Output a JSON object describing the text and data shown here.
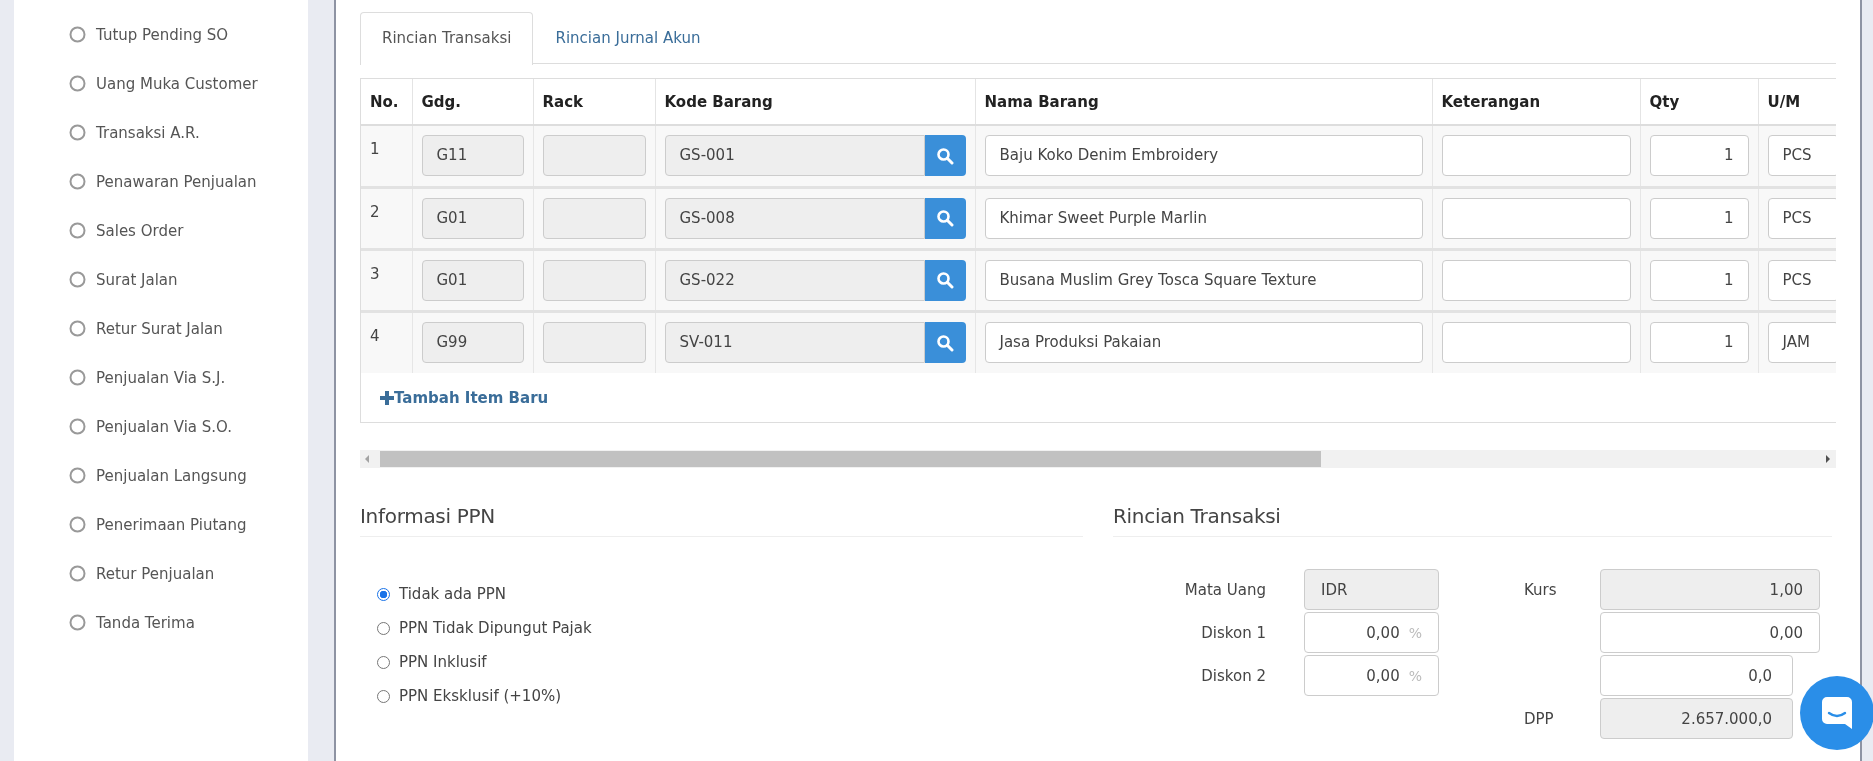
{
  "sidebar": {
    "items": [
      {
        "label": "Tutup Pending SO"
      },
      {
        "label": "Uang Muka Customer"
      },
      {
        "label": "Transaksi A.R."
      },
      {
        "label": "Penawaran Penjualan"
      },
      {
        "label": "Sales Order"
      },
      {
        "label": "Surat Jalan"
      },
      {
        "label": "Retur Surat Jalan"
      },
      {
        "label": "Penjualan Via S.J."
      },
      {
        "label": "Penjualan Via S.O."
      },
      {
        "label": "Penjualan Langsung"
      },
      {
        "label": "Penerimaan Piutang"
      },
      {
        "label": "Retur Penjualan"
      },
      {
        "label": "Tanda Terima"
      }
    ]
  },
  "tabs": [
    {
      "label": "Rincian Transaksi",
      "selected": true
    },
    {
      "label": "Rincian Jurnal Akun",
      "selected": false
    }
  ],
  "table": {
    "columns": [
      "No.",
      "Gdg.",
      "Rack",
      "Kode Barang",
      "Nama Barang",
      "Keterangan",
      "Qty",
      "U/M"
    ],
    "rows": [
      {
        "no": "1",
        "warehouse": "G11",
        "item_code": "GS-001",
        "item_name": "Baju Koko Denim Embroidery",
        "qty": "1",
        "unit": "PCS"
      },
      {
        "no": "2",
        "warehouse": "G01",
        "item_code": "GS-008",
        "item_name": "Khimar Sweet Purple Marlin",
        "qty": "1",
        "unit": "PCS"
      },
      {
        "no": "3",
        "warehouse": "G01",
        "item_code": "GS-022",
        "item_name": "Busana Muslim Grey Tosca Square Texture",
        "qty": "1",
        "unit": "PCS"
      },
      {
        "no": "4",
        "warehouse": "G99",
        "item_code": "SV-011",
        "item_name": "Jasa Produksi Pakaian",
        "qty": "1",
        "unit": "JAM"
      }
    ],
    "add_item_link": "Tambah Item Baru"
  },
  "ppn": {
    "title": "Informasi PPN",
    "options": [
      {
        "label": "Tidak ada PPN",
        "selected": true
      },
      {
        "label": "PPN Tidak Dipungut Pajak",
        "selected": false
      },
      {
        "label": "PPN Inklusif",
        "selected": false
      },
      {
        "label": "PPN Eksklusif (+10%)",
        "selected": false
      }
    ]
  },
  "summary": {
    "title": "Rincian Transaksi",
    "left_fields": [
      {
        "label": "Mata Uang",
        "value": "IDR",
        "readonly": true
      },
      {
        "label": "Diskon 1",
        "value": "0,00",
        "suffix": "%",
        "readonly": false
      },
      {
        "label": "Diskon 2",
        "value": "0,00",
        "suffix": "%",
        "readonly": false
      }
    ],
    "right_fields": [
      {
        "label": "Kurs",
        "value": "1,00",
        "readonly": true
      },
      {
        "value": "0,00",
        "readonly": false
      },
      {
        "value": "0,0",
        "readonly": false
      },
      {
        "label": "DPP",
        "value": "2.657.000,0",
        "readonly": true
      }
    ]
  }
}
